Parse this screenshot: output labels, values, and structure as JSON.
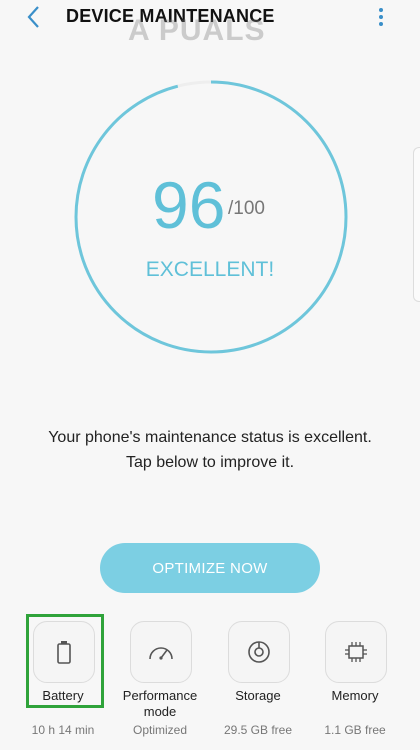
{
  "header": {
    "title": "DEVICE MAINTENANCE",
    "watermark": "A  PUALS"
  },
  "score": {
    "value": "96",
    "max": "/100",
    "rating": "EXCELLENT!"
  },
  "message": {
    "line1": "Your phone's maintenance status is excellent.",
    "line2": "Tap below to improve it."
  },
  "actions": {
    "optimize_label": "OPTIMIZE NOW"
  },
  "tiles": [
    {
      "label": "Battery",
      "value": "10 h 14 min",
      "icon": "battery-icon"
    },
    {
      "label": "Performance mode",
      "label_line1": "Performance",
      "label_line2": "mode",
      "value": "Optimized",
      "icon": "speedometer-icon"
    },
    {
      "label": "Storage",
      "value": "29.5 GB free",
      "icon": "storage-icon"
    },
    {
      "label": "Memory",
      "value": "1.1 GB free",
      "icon": "memory-chip-icon"
    }
  ],
  "colors": {
    "accent": "#5fc0d8",
    "button": "#7ccfe3",
    "highlight": "#2fa33a",
    "icon_blue": "#3a8fc9"
  },
  "gauge_fraction": 0.96
}
